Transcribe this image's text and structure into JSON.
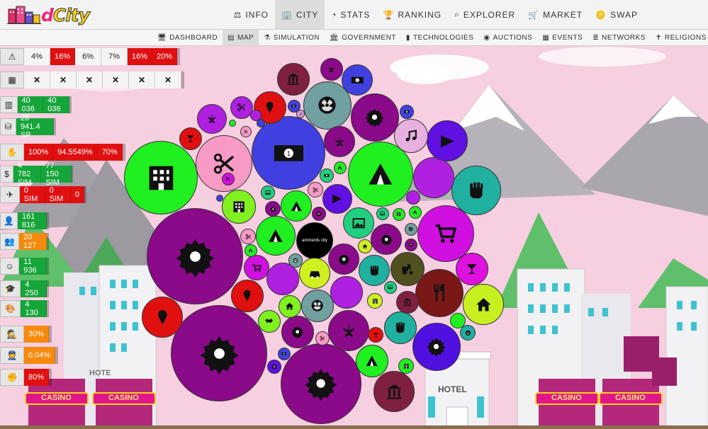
{
  "colors": {
    "accent": "#f0267a",
    "green": "#16a53a",
    "red": "#e01010",
    "orange": "#f58a0c",
    "sky": "#f6cfe0"
  },
  "logo": {
    "text_d": "d",
    "text_city": "City"
  },
  "nav": [
    {
      "icon": "scale-icon",
      "glyph": "⚖",
      "label": "INFO"
    },
    {
      "icon": "building-icon",
      "glyph": "🏢",
      "label": "CITY",
      "active": true
    },
    {
      "icon": "pie-chart-icon",
      "glyph": "◔",
      "label": "STATS"
    },
    {
      "icon": "trophy-icon",
      "glyph": "🏆",
      "label": "RANKING"
    },
    {
      "icon": "search-icon",
      "glyph": "⌕",
      "label": "EXPLORER"
    },
    {
      "icon": "cart-icon",
      "glyph": "🛒",
      "label": "MARKET"
    },
    {
      "icon": "coins-icon",
      "glyph": "🪙",
      "label": "SWAP"
    }
  ],
  "subnav": [
    {
      "icon": "desktop-icon",
      "glyph": "🖥",
      "label": "DASHBOARD"
    },
    {
      "icon": "map-icon",
      "glyph": "▤",
      "label": "MAP",
      "active": true
    },
    {
      "icon": "simulation-icon",
      "glyph": "⚗",
      "label": "SIMULATION"
    },
    {
      "icon": "government-icon",
      "glyph": "🏛",
      "label": "GOVERNMENT"
    },
    {
      "icon": "tech-icon",
      "glyph": "▮",
      "label": "TECHNOLOGIES"
    },
    {
      "icon": "auction-icon",
      "glyph": "◉",
      "label": "AUCTIONS"
    },
    {
      "icon": "calendar-icon",
      "glyph": "▦",
      "label": "EVENTS"
    },
    {
      "icon": "networks-icon",
      "glyph": "≣",
      "label": "NETWORKS"
    },
    {
      "icon": "religion-icon",
      "glyph": "✝",
      "label": "RELIGIONS"
    }
  ],
  "stats": [
    {
      "key": "alerts",
      "icon": "warning-icon",
      "glyph": "⚠",
      "cells": [
        {
          "v": "4%",
          "c": "white"
        },
        {
          "v": "16%",
          "c": "red"
        },
        {
          "v": "6%",
          "c": "white"
        },
        {
          "v": "7%",
          "c": "white"
        },
        {
          "v": "16%",
          "c": "red"
        },
        {
          "v": "20%",
          "c": "red"
        }
      ]
    },
    {
      "key": "calendar",
      "icon": "calendar-icon",
      "glyph": "▦",
      "cells": [
        {
          "v": "✕",
          "c": "x"
        },
        {
          "v": "✕",
          "c": "x"
        },
        {
          "v": "✕",
          "c": "x"
        },
        {
          "v": "✕",
          "c": "x"
        },
        {
          "v": "✕",
          "c": "x"
        },
        {
          "v": "✕",
          "c": "x"
        }
      ]
    },
    {
      "key": "buildings",
      "icon": "building-icon",
      "glyph": "▥",
      "cells": [
        {
          "v": "40 036",
          "c": "green"
        },
        {
          "v": "40 036",
          "c": "green"
        }
      ]
    },
    {
      "key": "money",
      "icon": "money-icon",
      "glyph": "⛁",
      "cells": [
        {
          "v": "28 941.4 SP",
          "c": "green"
        }
      ]
    },
    {
      "key": "hand",
      "icon": "hand-icon",
      "glyph": "✋",
      "cells": [
        {
          "v": "100%",
          "c": "red"
        },
        {
          "v": "94.5549%",
          "c": "red"
        },
        {
          "v": "70%",
          "c": "red"
        }
      ]
    },
    {
      "key": "dollar",
      "icon": "dollar-icon",
      "glyph": "$",
      "cells": [
        {
          "v": "4 782 SIM",
          "c": "green"
        },
        {
          "v": "77 150 SIM",
          "c": "green"
        }
      ]
    },
    {
      "key": "flight",
      "icon": "plane-icon",
      "glyph": "✈",
      "cells": [
        {
          "v": "0 SIM",
          "c": "red"
        },
        {
          "v": "0 SIM",
          "c": "red"
        },
        {
          "v": "0",
          "c": "red"
        }
      ]
    },
    {
      "key": "population",
      "icon": "user-icon",
      "glyph": "👤",
      "cells": [
        {
          "v": "161 816",
          "c": "green"
        }
      ]
    },
    {
      "key": "group",
      "icon": "users-icon",
      "glyph": "👥",
      "cells": [
        {
          "v": "20 127",
          "c": "orange"
        }
      ]
    },
    {
      "key": "happy",
      "icon": "smile-icon",
      "glyph": "☺",
      "cells": [
        {
          "v": "11 936",
          "c": "green"
        }
      ]
    },
    {
      "key": "education",
      "icon": "graduation-icon",
      "glyph": "🎓",
      "cells": [
        {
          "v": "4 250",
          "c": "green"
        }
      ]
    },
    {
      "key": "art",
      "icon": "palette-icon",
      "glyph": "🎨",
      "cells": [
        {
          "v": "4 130",
          "c": "green"
        }
      ]
    },
    {
      "key": "crime",
      "icon": "thief-icon",
      "glyph": "🕵",
      "cells": [
        {
          "v": "30%",
          "c": "orange"
        }
      ]
    },
    {
      "key": "police",
      "icon": "police-icon",
      "glyph": "👮",
      "cells": [
        {
          "v": "0.04%",
          "c": "orange"
        }
      ]
    },
    {
      "key": "fist",
      "icon": "fist-icon",
      "glyph": "✊",
      "cells": [
        {
          "v": "80%",
          "c": "red"
        }
      ]
    }
  ],
  "map": {
    "owner_label": "ammerds city",
    "sign_hotel": "HOTEL",
    "sign_casino": "CASINO",
    "sign_hotel_short": "HOTE"
  }
}
